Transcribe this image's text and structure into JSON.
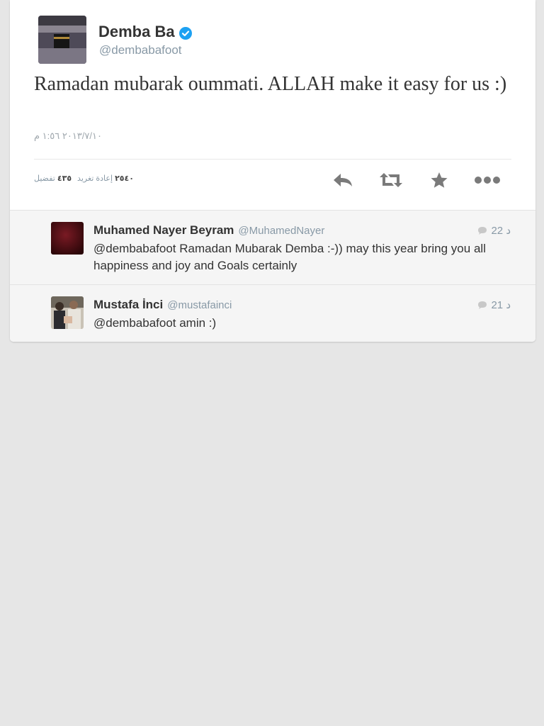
{
  "colors": {
    "background": "#e6e6e6",
    "card": "#ffffff",
    "reply_bg": "#f5f5f5",
    "verified": "#1da1f2",
    "muted": "#8899a6",
    "icon": "#7a7a7a"
  },
  "tweet": {
    "name": "Demba Ba",
    "handle": "@dembabafoot",
    "verified_icon": "verified-badge-icon",
    "text": "Ramadan mubarak oummati. ALLAH make it easy for us :)",
    "timestamp": "٢٠١٣/٧/١٠ ١:٥٦ م",
    "retweets_count": "٢٥٤٠",
    "retweets_label": "إعادة تغريد",
    "favorites_count": "٤٣٥",
    "favorites_label": "تفضيل",
    "actions": {
      "reply_icon": "reply-icon",
      "retweet_icon": "retweet-icon",
      "favorite_icon": "star-icon",
      "more_icon": "more-dots-icon"
    }
  },
  "replies": [
    {
      "name": "Muhamed Nayer Beyram",
      "handle": "@MuhamedNayer",
      "time": "22 د",
      "text": "@dembabafoot Ramadan Mubarak Demba :-)) may this year bring you all happiness and joy and Goals certainly"
    },
    {
      "name": "Mustafa İnci",
      "handle": "@mustafainci",
      "time": "21 د",
      "text": "@dembabafoot amin :)"
    }
  ]
}
